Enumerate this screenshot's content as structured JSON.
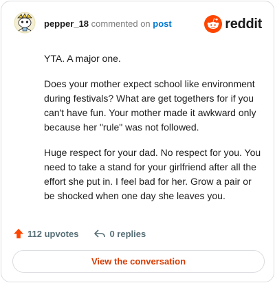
{
  "comment": {
    "username": "pepper_18",
    "commented_on_text": "commented on",
    "post_link": "post",
    "paragraphs": [
      "YTA. A major one.",
      "Does your mother expect school like environment during festivals? What are get togethers for if you can't have fun. Your mother made it awkward only because her \"rule\" was not followed.",
      "Huge respect for your dad. No respect for you. You need to take a stand for your girlfriend after all the effort she put in. I feel bad for her. Grow a pair or be shocked when one day she leaves you."
    ]
  },
  "brand": {
    "name": "reddit",
    "logo_icon": "reddit-snoo-icon",
    "accent": "#ff4500"
  },
  "actions": {
    "upvotes_label": "112 upvotes",
    "upvote_icon": "upvote-arrow-icon",
    "upvote_color": "#ff4500",
    "replies_label": "0 replies",
    "reply_icon": "reply-arrow-icon"
  },
  "cta": {
    "label": "View the conversation",
    "color": "#d93a00"
  }
}
